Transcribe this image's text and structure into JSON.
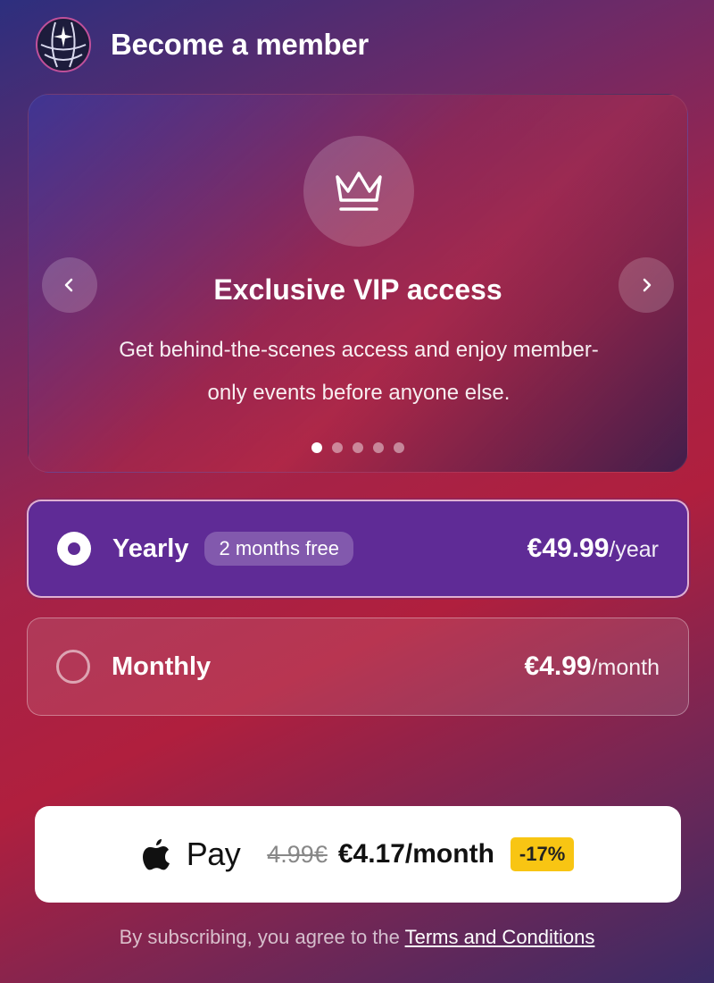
{
  "header": {
    "title": "Become a member"
  },
  "carousel": {
    "slide_title": "Exclusive VIP access",
    "slide_description": "Get behind-the-scenes access and enjoy member-only events before anyone else.",
    "total_slides": 5,
    "active_slide": 1,
    "prev_icon": "chevron-left-icon",
    "next_icon": "chevron-right-icon",
    "slide_icon": "crown-icon"
  },
  "plans": {
    "yearly": {
      "name": "Yearly",
      "badge": "2 months free",
      "price": "€49.99",
      "period": "/year",
      "selected": true
    },
    "monthly": {
      "name": "Monthly",
      "price": "€4.99",
      "period": "/month",
      "selected": false
    }
  },
  "payment": {
    "label": "Pay",
    "old_price": "4.99€",
    "new_price": "€4.17/month",
    "discount": "-17%",
    "discount_color": "#f8c513"
  },
  "footer": {
    "text": "By subscribing, you agree to the ",
    "link": "Terms and Conditions"
  },
  "colors": {
    "selected_plan": "#5f2b96",
    "accent_border": "#c0509a"
  }
}
